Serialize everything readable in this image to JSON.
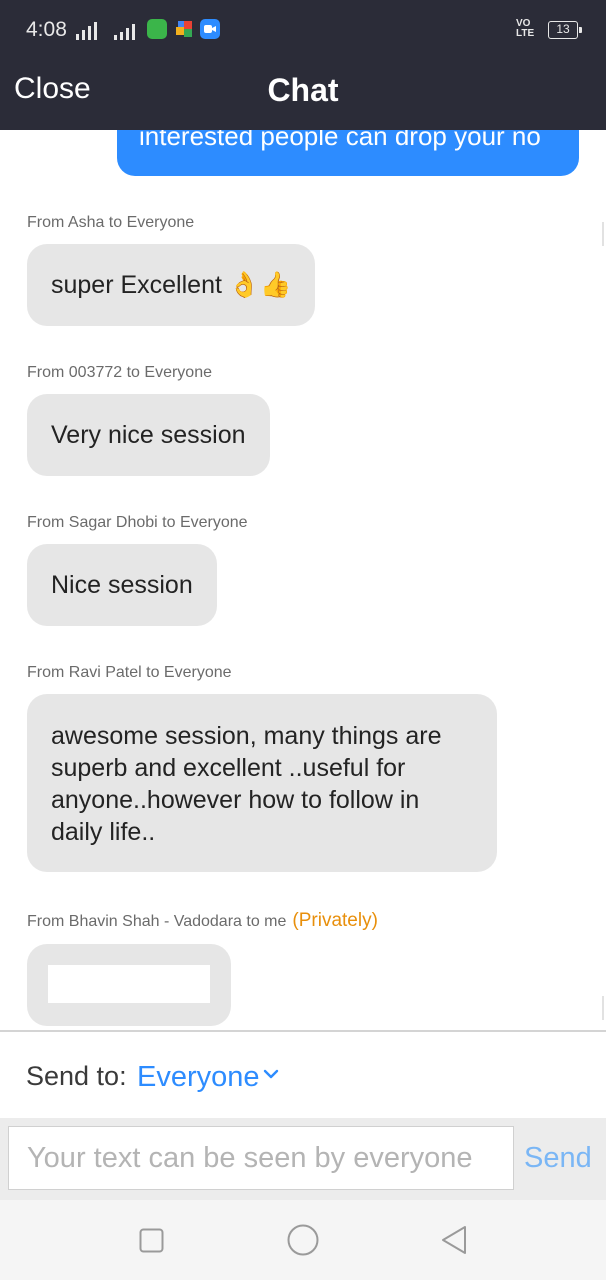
{
  "status_bar": {
    "time": "4:08",
    "network": "4G",
    "volte": "VO\nLTE",
    "battery": "13"
  },
  "header": {
    "close_label": "Close",
    "title": "Chat"
  },
  "own_message": {
    "text": "interested people can drop your no"
  },
  "messages": [
    {
      "meta": "From Asha to Everyone",
      "text": "super Excellent 👌👍"
    },
    {
      "meta": "From 003772 to Everyone",
      "text": "Very nice session"
    },
    {
      "meta": "From Sagar Dhobi to Everyone",
      "text": "Nice session"
    },
    {
      "meta": "From Ravi Patel to Everyone",
      "text": "awesome session, many things are superb and excellent ..useful for anyone..however how to follow in daily life.."
    },
    {
      "meta": "From Bhavin Shah - Vadodara to me",
      "private_tag": "(Privately)",
      "text": ""
    }
  ],
  "send_to": {
    "label": "Send to:",
    "value": "Everyone"
  },
  "composer": {
    "placeholder": "Your text can be seen by everyone",
    "send_label": "Send"
  },
  "nav": {
    "recents": "recents-icon",
    "home": "home-icon",
    "back": "back-icon"
  },
  "colors": {
    "accent": "#2d8cff",
    "header_bg": "#2b2c38",
    "bubble_bg": "#e6e6e6",
    "private": "#e88f0b"
  }
}
